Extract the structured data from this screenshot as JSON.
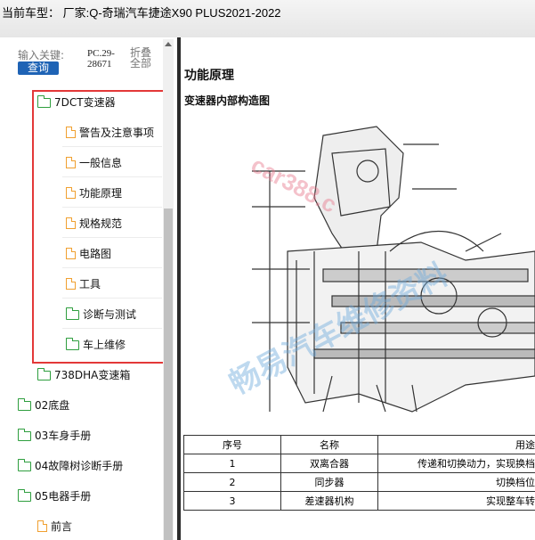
{
  "header": {
    "title": "当前车型： 厂家:Q-奇瑞汽车捷途X90 PLUS2021-2022"
  },
  "search": {
    "keyword_label": "输入关键:",
    "query_button": "查询",
    "pc_code": "PC.29-28671",
    "collapse_all": "折叠全部"
  },
  "tree": {
    "items": [
      {
        "label": "7DCT变速器",
        "icon": "folder-icon"
      },
      {
        "label": "警告及注意事项",
        "icon": "file-icon"
      },
      {
        "label": "一般信息",
        "icon": "file-icon"
      },
      {
        "label": "功能原理",
        "icon": "file-icon"
      },
      {
        "label": "规格规范",
        "icon": "file-icon"
      },
      {
        "label": "电路图",
        "icon": "file-icon"
      },
      {
        "label": "工具",
        "icon": "file-icon"
      },
      {
        "label": "诊断与测试",
        "icon": "folder-icon"
      },
      {
        "label": "车上维修",
        "icon": "folder-icon"
      },
      {
        "label": "738DHA变速箱",
        "icon": "folder-icon"
      },
      {
        "label": "02底盘",
        "icon": "folder-icon"
      },
      {
        "label": "03车身手册",
        "icon": "folder-icon"
      },
      {
        "label": "04故障树诊断手册",
        "icon": "folder-icon"
      },
      {
        "label": "05电器手册",
        "icon": "folder-icon"
      },
      {
        "label": "前言",
        "icon": "file-icon"
      }
    ]
  },
  "content": {
    "page_title": "功能原理",
    "section_title": "变速器内部构造图",
    "watermark_en": "car388.c",
    "watermark_cn": "畅易汽车维修资料",
    "table": {
      "headers": [
        "序号",
        "名称",
        "用途"
      ],
      "rows": [
        [
          "1",
          "双离合器",
          "传递和切换动力，实现换档"
        ],
        [
          "2",
          "同步器",
          "切换档位"
        ],
        [
          "3",
          "差速器机构",
          "实现整车转"
        ]
      ]
    }
  },
  "colors": {
    "highlight": "#e33838",
    "query_button": "#1e63b5",
    "folder": "#2e9e3e",
    "file": "#f0a030"
  }
}
